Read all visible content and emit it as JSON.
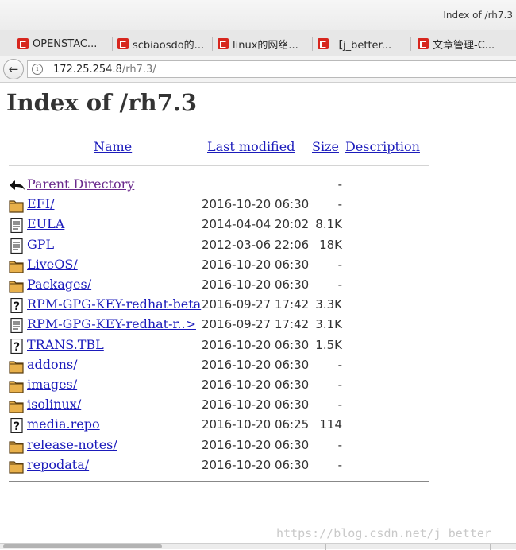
{
  "window": {
    "title": "Index of /rh7.3"
  },
  "tabs": [
    {
      "label": "OPENSTAC...",
      "icon": "csdn-icon"
    },
    {
      "label": "scbiaosdo的...",
      "icon": "csdn-icon"
    },
    {
      "label": "linux的网络...",
      "icon": "csdn-icon"
    },
    {
      "label": "【j_better...",
      "icon": "csdn-icon"
    },
    {
      "label": "文章管理-C...",
      "icon": "csdn-icon"
    }
  ],
  "navbar": {
    "host": "172.25.254.8",
    "path": "/rh7.3/"
  },
  "page": {
    "heading": "Index of /rh7.3",
    "columns": {
      "name": "Name",
      "modified": "Last modified",
      "size": "Size",
      "description": "Description"
    },
    "rows": [
      {
        "icon": "back-icon",
        "name": "Parent Directory",
        "modified": "",
        "size": "-",
        "visited": true
      },
      {
        "icon": "folder-icon",
        "name": "EFI/",
        "modified": "2016-10-20 06:30",
        "size": "-"
      },
      {
        "icon": "text-file-icon",
        "name": "EULA",
        "modified": "2014-04-04 20:02",
        "size": "8.1K"
      },
      {
        "icon": "text-file-icon",
        "name": "GPL",
        "modified": "2012-03-06 22:06",
        "size": "18K"
      },
      {
        "icon": "folder-icon",
        "name": "LiveOS/",
        "modified": "2016-10-20 06:30",
        "size": "-"
      },
      {
        "icon": "folder-icon",
        "name": "Packages/",
        "modified": "2016-10-20 06:30",
        "size": "-"
      },
      {
        "icon": "unknown-file-icon",
        "name": "RPM-GPG-KEY-redhat-beta",
        "modified": "2016-09-27 17:42",
        "size": "3.3K"
      },
      {
        "icon": "text-file-icon",
        "name": "RPM-GPG-KEY-redhat-r..>",
        "modified": "2016-09-27 17:42",
        "size": "3.1K"
      },
      {
        "icon": "unknown-file-icon",
        "name": "TRANS.TBL",
        "modified": "2016-10-20 06:30",
        "size": "1.5K"
      },
      {
        "icon": "folder-icon",
        "name": "addons/",
        "modified": "2016-10-20 06:30",
        "size": "-"
      },
      {
        "icon": "folder-icon",
        "name": "images/",
        "modified": "2016-10-20 06:30",
        "size": "-"
      },
      {
        "icon": "folder-icon",
        "name": "isolinux/",
        "modified": "2016-10-20 06:30",
        "size": "-"
      },
      {
        "icon": "unknown-file-icon",
        "name": "media.repo",
        "modified": "2016-10-20 06:25",
        "size": "114"
      },
      {
        "icon": "folder-icon",
        "name": "release-notes/",
        "modified": "2016-10-20 06:30",
        "size": "-"
      },
      {
        "icon": "folder-icon",
        "name": "repodata/",
        "modified": "2016-10-20 06:30",
        "size": "-"
      }
    ]
  },
  "watermark": "https://blog.csdn.net/j_better",
  "colors": {
    "link": "#1b1bbb",
    "visited_link": "#6a2a8c",
    "favicon": "#d7261e",
    "folder": "#e8b04a"
  }
}
